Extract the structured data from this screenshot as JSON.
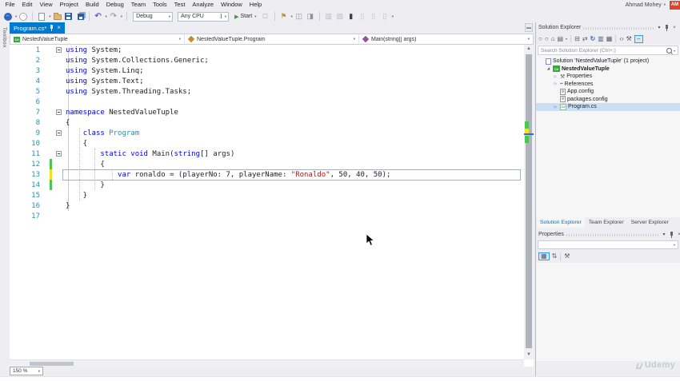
{
  "window": {
    "user": {
      "name": "Ahmad Mohey",
      "avatar_initials": "AM",
      "avatar_color": "#D6492F"
    },
    "watermark": "Udemy"
  },
  "colors": {
    "accent": "#007ACC",
    "keyword": "#0000FF",
    "type_name": "#2B91AF",
    "string": "#A31515",
    "line_number": "#2B91AF",
    "change_saved": "#4CC552",
    "change_unsaved": "#F2E11C",
    "active_tab_bg": "#007ACC"
  },
  "menu": {
    "items": [
      "File",
      "Edit",
      "View",
      "Project",
      "Build",
      "Debug",
      "Team",
      "Tools",
      "Test",
      "Analyze",
      "Window",
      "Help"
    ]
  },
  "toolbar": {
    "items": [
      {
        "name": "nav-back-button",
        "icon": "nav-back-icon",
        "glyph": "←",
        "cls": "circ-blue",
        "caret": true
      },
      {
        "name": "nav-forward-button",
        "icon": "nav-forward-icon",
        "glyph": "→",
        "cls": "circ-gray"
      },
      {
        "sep": true
      },
      {
        "name": "new-file-button",
        "icon": "new-file-icon",
        "shape": "file",
        "caret": true
      },
      {
        "name": "open-file-button",
        "icon": "open-folder-icon",
        "shape": "folder"
      },
      {
        "name": "save-button",
        "icon": "save-icon",
        "shape": "floppy"
      },
      {
        "name": "save-all-button",
        "icon": "save-all-icon",
        "shape": "floppy2"
      },
      {
        "sep": true
      },
      {
        "name": "undo-button",
        "icon": "undo-icon",
        "glyph": "↶",
        "cls": "undo",
        "caret": true
      },
      {
        "name": "redo-button",
        "icon": "redo-icon",
        "glyph": "↷",
        "cls": "redo",
        "caret": true
      },
      {
        "sep": true
      },
      {
        "dropdown": "Debug",
        "name": "solution-configurations-dropdown",
        "w": 50
      },
      {
        "dropdown": "Any CPU",
        "name": "solution-platforms-dropdown",
        "w": 64,
        "ibeam": true
      },
      {
        "start": true,
        "label": "Start",
        "name": "start-debug-button"
      },
      {
        "name": "attach-to-process-button",
        "icon": "attach-icon",
        "glyph": "□",
        "cls": "dim"
      },
      {
        "sep": true
      },
      {
        "name": "flag-button",
        "icon": "flag-icon",
        "glyph": "⚑",
        "cls": "flag",
        "caret": true
      },
      {
        "name": "comment-button",
        "icon": "comment-icon",
        "glyph": "◫",
        "cls": "dim"
      },
      {
        "name": "uncomment-button",
        "icon": "uncomment-icon",
        "glyph": "◨",
        "cls": "dim"
      },
      {
        "sep": true
      },
      {
        "name": "indent-button",
        "icon": "indent-icon",
        "glyph": "▥",
        "cls": "faint"
      },
      {
        "name": "outdent-button",
        "icon": "outdent-icon",
        "glyph": "▨",
        "cls": "faint"
      },
      {
        "name": "bookmark-button",
        "icon": "bookmark-icon",
        "glyph": "▮",
        "cls": "dark"
      },
      {
        "name": "prev-bookmark-button",
        "icon": "prev-bookmark-icon",
        "glyph": "▯",
        "cls": "faint"
      },
      {
        "name": "next-bookmark-button",
        "icon": "next-bookmark-icon",
        "glyph": "▯",
        "cls": "faint"
      },
      {
        "name": "clear-bookmarks-button",
        "icon": "clear-bookmarks-icon",
        "glyph": "▯",
        "cls": "faint",
        "caret": true
      }
    ]
  },
  "editor": {
    "toolbox_tab": "Toolbox",
    "tab": {
      "title": "Program.cs*"
    },
    "navigation": [
      {
        "name": "nav-project-dropdown",
        "icon": "project-icon",
        "label": "NestedValueTuple"
      },
      {
        "name": "nav-type-dropdown",
        "icon": "class-icon",
        "label": "NestedValueTuple.Program"
      },
      {
        "name": "nav-member-dropdown",
        "icon": "method-icon",
        "label": "Main(string[] args)"
      }
    ],
    "zoom": "150 %",
    "code_lines": [
      {
        "n": 1,
        "fold": true,
        "segs": [
          [
            "using",
            "k"
          ],
          [
            " System;",
            "p"
          ]
        ]
      },
      {
        "n": 2,
        "segs": [
          [
            "using",
            "k"
          ],
          [
            " System.Collections.Generic;",
            "p"
          ]
        ]
      },
      {
        "n": 3,
        "segs": [
          [
            "using",
            "k"
          ],
          [
            " System.Linq;",
            "p"
          ]
        ]
      },
      {
        "n": 4,
        "segs": [
          [
            "using",
            "k"
          ],
          [
            " System.Text;",
            "p"
          ]
        ]
      },
      {
        "n": 5,
        "segs": [
          [
            "using",
            "k"
          ],
          [
            " System.Threading.Tasks;",
            "p"
          ]
        ]
      },
      {
        "n": 6,
        "segs": []
      },
      {
        "n": 7,
        "fold": true,
        "segs": [
          [
            "namespace",
            "k"
          ],
          [
            " NestedValueTuple",
            "p"
          ]
        ]
      },
      {
        "n": 8,
        "segs": [
          [
            "{",
            "p"
          ]
        ]
      },
      {
        "n": 9,
        "fold": true,
        "segs": [
          [
            "    ",
            "p"
          ],
          [
            "class",
            "k"
          ],
          [
            " ",
            "p"
          ],
          [
            "Program",
            "t"
          ]
        ]
      },
      {
        "n": 10,
        "segs": [
          [
            "    {",
            "p"
          ]
        ]
      },
      {
        "n": 11,
        "fold": true,
        "segs": [
          [
            "        ",
            "p"
          ],
          [
            "static",
            "k"
          ],
          [
            " ",
            "p"
          ],
          [
            "void",
            "k"
          ],
          [
            " Main(",
            "p"
          ],
          [
            "string",
            "k"
          ],
          [
            "[] args)",
            "p"
          ]
        ]
      },
      {
        "n": 12,
        "chg": "g",
        "segs": [
          [
            "        {",
            "p"
          ]
        ]
      },
      {
        "n": 13,
        "chg": "y",
        "cur": true,
        "segs": [
          [
            "            ",
            "p"
          ],
          [
            "var",
            "k"
          ],
          [
            " ronaldo = (playerNo: 7, playerName: ",
            "p"
          ],
          [
            "\"Ronaldo\"",
            "s"
          ],
          [
            ", 50, 40, 50);",
            "p"
          ]
        ]
      },
      {
        "n": 14,
        "chg": "g",
        "segs": [
          [
            "        }",
            "p"
          ]
        ]
      },
      {
        "n": 15,
        "segs": [
          [
            "    }",
            "p"
          ]
        ]
      },
      {
        "n": 16,
        "segs": [
          [
            "}",
            "p"
          ]
        ]
      },
      {
        "n": 17,
        "segs": []
      }
    ]
  },
  "solution_explorer": {
    "title": "Solution Explorer",
    "search_placeholder": "Search Solution Explorer (Ctrl+;)",
    "tree": [
      {
        "label": "Solution 'NestedValueTuple' (1 project)",
        "icon": "solution",
        "level": 0
      },
      {
        "label": "NestedValueTuple",
        "icon": "csproject",
        "level": 1,
        "expander": "open",
        "bold": true
      },
      {
        "label": "Properties",
        "icon": "wrench",
        "level": 2,
        "expander": "closed"
      },
      {
        "label": "References",
        "icon": "references",
        "level": 2,
        "expander": "closed"
      },
      {
        "label": "App.config",
        "icon": "config",
        "level": 2
      },
      {
        "label": "packages.config",
        "icon": "config",
        "level": 2
      },
      {
        "label": "Program.cs",
        "icon": "csfile",
        "level": 2,
        "expander": "closed",
        "selected": true
      }
    ]
  },
  "panel_tabs": [
    {
      "label": "Solution Explorer",
      "active": true
    },
    {
      "label": "Team Explorer"
    },
    {
      "label": "Server Explorer"
    }
  ],
  "properties_panel": {
    "title": "Properties"
  }
}
